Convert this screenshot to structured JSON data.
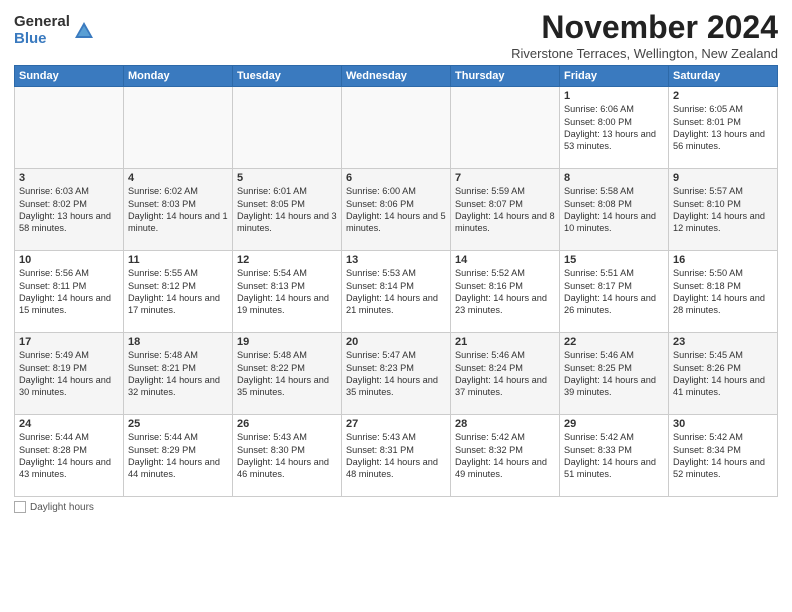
{
  "logo": {
    "general": "General",
    "blue": "Blue"
  },
  "title": "November 2024",
  "subtitle": "Riverstone Terraces, Wellington, New Zealand",
  "days_of_week": [
    "Sunday",
    "Monday",
    "Tuesday",
    "Wednesday",
    "Thursday",
    "Friday",
    "Saturday"
  ],
  "legend": {
    "daylight_label": "Daylight hours"
  },
  "weeks": [
    [
      {
        "day": "",
        "sunrise": "",
        "sunset": "",
        "daylight": ""
      },
      {
        "day": "",
        "sunrise": "",
        "sunset": "",
        "daylight": ""
      },
      {
        "day": "",
        "sunrise": "",
        "sunset": "",
        "daylight": ""
      },
      {
        "day": "",
        "sunrise": "",
        "sunset": "",
        "daylight": ""
      },
      {
        "day": "",
        "sunrise": "",
        "sunset": "",
        "daylight": ""
      },
      {
        "day": "1",
        "sunrise": "Sunrise: 6:06 AM",
        "sunset": "Sunset: 8:00 PM",
        "daylight": "Daylight: 13 hours and 53 minutes."
      },
      {
        "day": "2",
        "sunrise": "Sunrise: 6:05 AM",
        "sunset": "Sunset: 8:01 PM",
        "daylight": "Daylight: 13 hours and 56 minutes."
      }
    ],
    [
      {
        "day": "3",
        "sunrise": "Sunrise: 6:03 AM",
        "sunset": "Sunset: 8:02 PM",
        "daylight": "Daylight: 13 hours and 58 minutes."
      },
      {
        "day": "4",
        "sunrise": "Sunrise: 6:02 AM",
        "sunset": "Sunset: 8:03 PM",
        "daylight": "Daylight: 14 hours and 1 minute."
      },
      {
        "day": "5",
        "sunrise": "Sunrise: 6:01 AM",
        "sunset": "Sunset: 8:05 PM",
        "daylight": "Daylight: 14 hours and 3 minutes."
      },
      {
        "day": "6",
        "sunrise": "Sunrise: 6:00 AM",
        "sunset": "Sunset: 8:06 PM",
        "daylight": "Daylight: 14 hours and 5 minutes."
      },
      {
        "day": "7",
        "sunrise": "Sunrise: 5:59 AM",
        "sunset": "Sunset: 8:07 PM",
        "daylight": "Daylight: 14 hours and 8 minutes."
      },
      {
        "day": "8",
        "sunrise": "Sunrise: 5:58 AM",
        "sunset": "Sunset: 8:08 PM",
        "daylight": "Daylight: 14 hours and 10 minutes."
      },
      {
        "day": "9",
        "sunrise": "Sunrise: 5:57 AM",
        "sunset": "Sunset: 8:10 PM",
        "daylight": "Daylight: 14 hours and 12 minutes."
      }
    ],
    [
      {
        "day": "10",
        "sunrise": "Sunrise: 5:56 AM",
        "sunset": "Sunset: 8:11 PM",
        "daylight": "Daylight: 14 hours and 15 minutes."
      },
      {
        "day": "11",
        "sunrise": "Sunrise: 5:55 AM",
        "sunset": "Sunset: 8:12 PM",
        "daylight": "Daylight: 14 hours and 17 minutes."
      },
      {
        "day": "12",
        "sunrise": "Sunrise: 5:54 AM",
        "sunset": "Sunset: 8:13 PM",
        "daylight": "Daylight: 14 hours and 19 minutes."
      },
      {
        "day": "13",
        "sunrise": "Sunrise: 5:53 AM",
        "sunset": "Sunset: 8:14 PM",
        "daylight": "Daylight: 14 hours and 21 minutes."
      },
      {
        "day": "14",
        "sunrise": "Sunrise: 5:52 AM",
        "sunset": "Sunset: 8:16 PM",
        "daylight": "Daylight: 14 hours and 23 minutes."
      },
      {
        "day": "15",
        "sunrise": "Sunrise: 5:51 AM",
        "sunset": "Sunset: 8:17 PM",
        "daylight": "Daylight: 14 hours and 26 minutes."
      },
      {
        "day": "16",
        "sunrise": "Sunrise: 5:50 AM",
        "sunset": "Sunset: 8:18 PM",
        "daylight": "Daylight: 14 hours and 28 minutes."
      }
    ],
    [
      {
        "day": "17",
        "sunrise": "Sunrise: 5:49 AM",
        "sunset": "Sunset: 8:19 PM",
        "daylight": "Daylight: 14 hours and 30 minutes."
      },
      {
        "day": "18",
        "sunrise": "Sunrise: 5:48 AM",
        "sunset": "Sunset: 8:21 PM",
        "daylight": "Daylight: 14 hours and 32 minutes."
      },
      {
        "day": "19",
        "sunrise": "Sunrise: 5:48 AM",
        "sunset": "Sunset: 8:22 PM",
        "daylight": "Daylight: 14 hours and 35 minutes."
      },
      {
        "day": "20",
        "sunrise": "Sunrise: 5:47 AM",
        "sunset": "Sunset: 8:23 PM",
        "daylight": "Daylight: 14 hours and 35 minutes."
      },
      {
        "day": "21",
        "sunrise": "Sunrise: 5:46 AM",
        "sunset": "Sunset: 8:24 PM",
        "daylight": "Daylight: 14 hours and 37 minutes."
      },
      {
        "day": "22",
        "sunrise": "Sunrise: 5:46 AM",
        "sunset": "Sunset: 8:25 PM",
        "daylight": "Daylight: 14 hours and 39 minutes."
      },
      {
        "day": "23",
        "sunrise": "Sunrise: 5:45 AM",
        "sunset": "Sunset: 8:26 PM",
        "daylight": "Daylight: 14 hours and 41 minutes."
      }
    ],
    [
      {
        "day": "24",
        "sunrise": "Sunrise: 5:44 AM",
        "sunset": "Sunset: 8:28 PM",
        "daylight": "Daylight: 14 hours and 43 minutes."
      },
      {
        "day": "25",
        "sunrise": "Sunrise: 5:44 AM",
        "sunset": "Sunset: 8:29 PM",
        "daylight": "Daylight: 14 hours and 44 minutes."
      },
      {
        "day": "26",
        "sunrise": "Sunrise: 5:43 AM",
        "sunset": "Sunset: 8:30 PM",
        "daylight": "Daylight: 14 hours and 46 minutes."
      },
      {
        "day": "27",
        "sunrise": "Sunrise: 5:43 AM",
        "sunset": "Sunset: 8:31 PM",
        "daylight": "Daylight: 14 hours and 48 minutes."
      },
      {
        "day": "28",
        "sunrise": "Sunrise: 5:42 AM",
        "sunset": "Sunset: 8:32 PM",
        "daylight": "Daylight: 14 hours and 49 minutes."
      },
      {
        "day": "29",
        "sunrise": "Sunrise: 5:42 AM",
        "sunset": "Sunset: 8:33 PM",
        "daylight": "Daylight: 14 hours and 51 minutes."
      },
      {
        "day": "30",
        "sunrise": "Sunrise: 5:42 AM",
        "sunset": "Sunset: 8:34 PM",
        "daylight": "Daylight: 14 hours and 52 minutes."
      }
    ]
  ]
}
